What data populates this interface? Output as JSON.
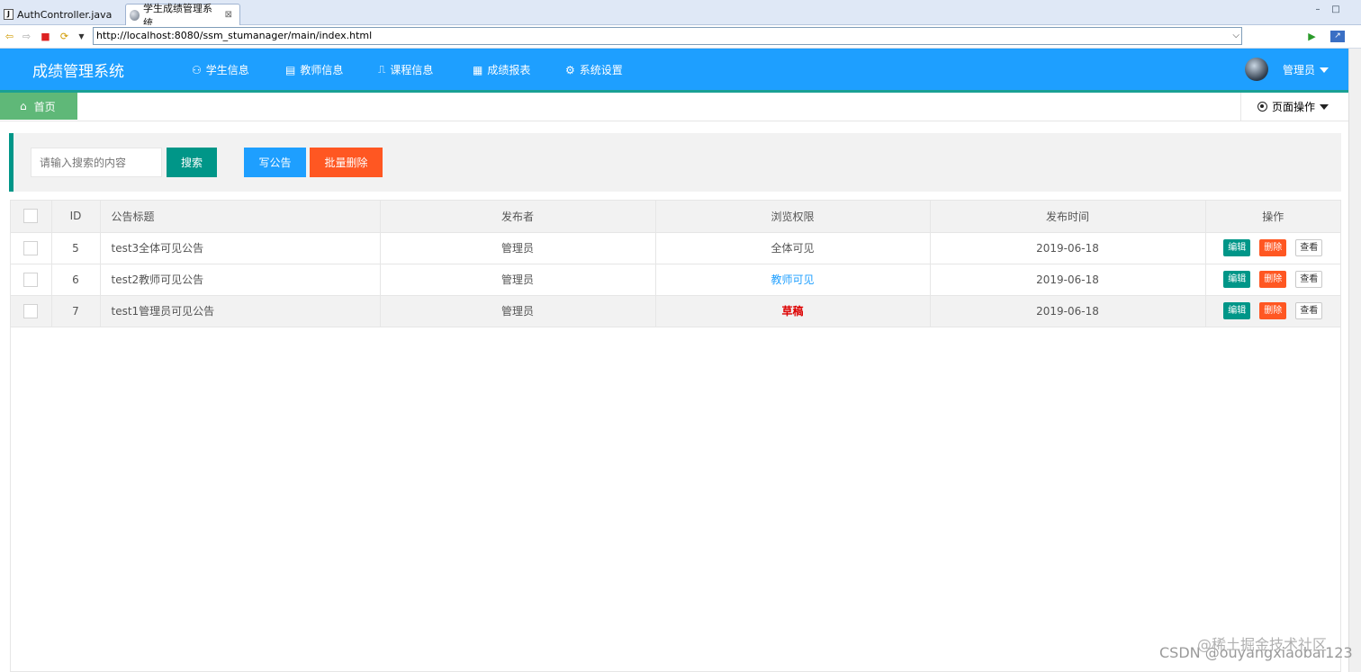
{
  "ide": {
    "tabs": [
      {
        "label": "AuthController.java",
        "icon": "java-file-icon"
      },
      {
        "label": "学生成绩管理系统",
        "icon": "globe-icon",
        "close": "⊠"
      }
    ],
    "url": "http://localhost:8080/ssm_stumanager/main/index.html"
  },
  "header": {
    "logo": "成绩管理系统",
    "nav": [
      {
        "label": "学生信息",
        "icon": "users-icon"
      },
      {
        "label": "教师信息",
        "icon": "document-icon"
      },
      {
        "label": "课程信息",
        "icon": "book-icon"
      },
      {
        "label": "成绩报表",
        "icon": "table-icon"
      },
      {
        "label": "系统设置",
        "icon": "gear-icon"
      }
    ],
    "user": "管理员"
  },
  "pagetabs": {
    "home": "首页",
    "page_ops": "页面操作"
  },
  "toolbar": {
    "search_placeholder": "请输入搜索的内容",
    "search_label": "搜索",
    "write_label": "写公告",
    "batch_delete_label": "批量删除"
  },
  "table": {
    "columns": [
      "ID",
      "公告标题",
      "发布者",
      "浏览权限",
      "发布时间",
      "操作"
    ],
    "rows": [
      {
        "id": "5",
        "title": "test3全体可见公告",
        "publisher": "管理员",
        "permission": "全体可见",
        "time": "2019-06-18"
      },
      {
        "id": "6",
        "title": "test2教师可见公告",
        "publisher": "管理员",
        "permission": "教师可见",
        "time": "2019-06-18"
      },
      {
        "id": "7",
        "title": "test1管理员可见公告",
        "publisher": "管理员",
        "permission": "草稿",
        "time": "2019-06-18"
      }
    ],
    "actions": {
      "edit": "编辑",
      "delete": "删除",
      "view": "查看"
    }
  },
  "watermark": "CSDN @ouyangxiaobai123",
  "watermark2": "@稀土掘金技术社区",
  "colors": {
    "header": "#1e9fff",
    "accent": "#009688",
    "danger": "#ff5722",
    "home_tab": "#5fb878"
  }
}
